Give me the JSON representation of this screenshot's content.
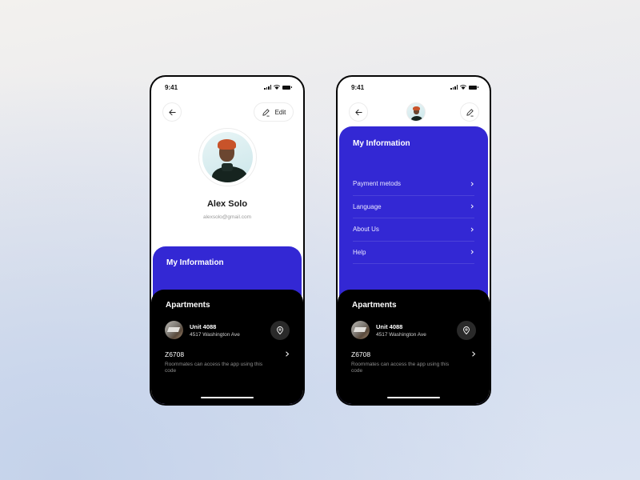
{
  "colors": {
    "accent_blue": "#3328d4",
    "panel_black": "#000000",
    "pin_button": "#2a2a2a"
  },
  "screens": [
    {
      "status_bar": {
        "time": "9:41",
        "icons": [
          "signal-icon",
          "wifi-icon",
          "battery-icon"
        ]
      },
      "header": {
        "back_icon": "arrow-left-icon",
        "edit_icon": "pencil-icon",
        "edit_label": "Edit"
      },
      "profile": {
        "name": "Alex Solo",
        "email": "alexsolo@gmail.com"
      },
      "info_panel": {
        "title": "My Information"
      },
      "apartments": {
        "title": "Apartments",
        "unit": "Unit 4088",
        "address": "4517 Washington Ave",
        "pin_icon": "map-pin-icon",
        "code": "Z6708",
        "code_description": "Roommates can access the app using this code"
      }
    },
    {
      "status_bar": {
        "time": "9:41",
        "icons": [
          "signal-icon",
          "wifi-icon",
          "battery-icon"
        ]
      },
      "header": {
        "back_icon": "arrow-left-icon",
        "edit_icon": "pencil-icon"
      },
      "info_panel": {
        "title": "My Information",
        "menu": [
          {
            "label": "Payment metods"
          },
          {
            "label": "Language"
          },
          {
            "label": "About Us"
          },
          {
            "label": "Help"
          }
        ]
      },
      "apartments": {
        "title": "Apartments",
        "unit": "Unit 4088",
        "address": "4517 Washington Ave",
        "pin_icon": "map-pin-icon",
        "code": "Z6708",
        "code_description": "Roommates can access the app using this code"
      }
    }
  ]
}
